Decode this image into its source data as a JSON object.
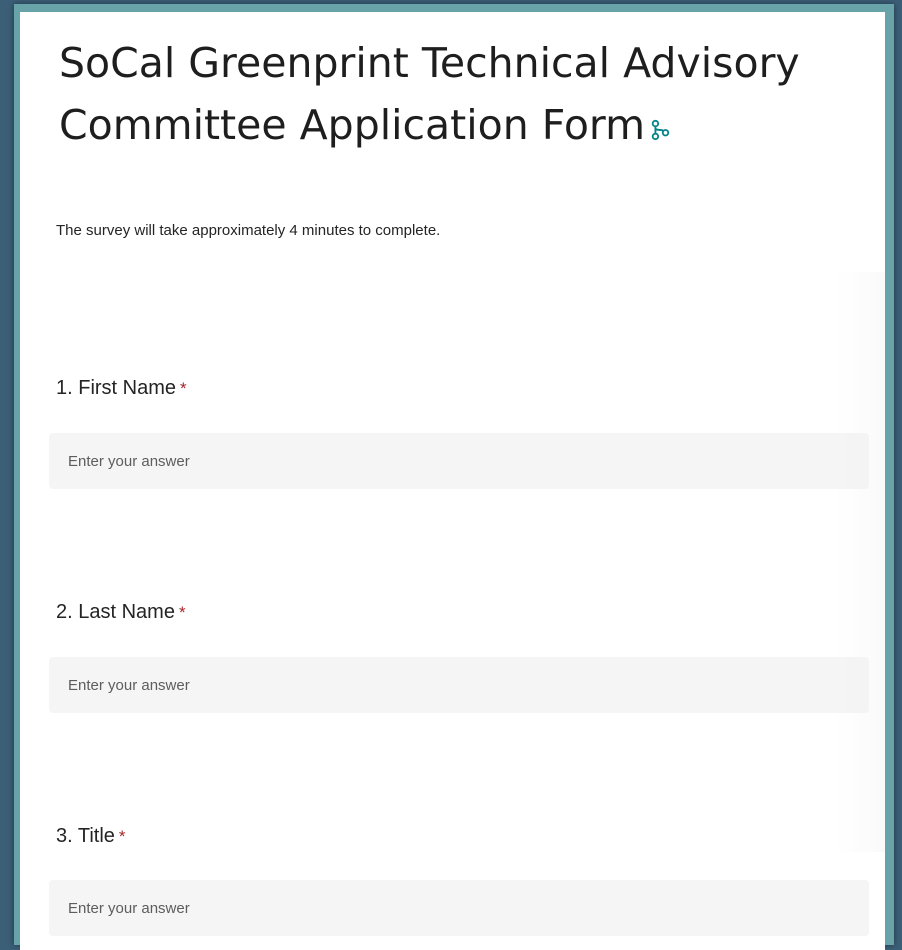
{
  "form": {
    "title": "SoCal Greenprint Technical Advisory Committee Application Form",
    "title_icon": "branch-icon",
    "description": "The survey will take approximately 4 minutes to complete.",
    "required_marker": "*",
    "questions": [
      {
        "label": "1. First Name",
        "placeholder": "Enter your answer",
        "required": true
      },
      {
        "label": "2. Last Name",
        "placeholder": "Enter your answer",
        "required": true
      },
      {
        "label": "3. Title",
        "placeholder": "Enter your answer",
        "required": true
      }
    ]
  },
  "colors": {
    "background": "#3c5f78",
    "frame": "#67a3a8",
    "card": "#ffffff",
    "input_bg": "#f5f5f5",
    "required": "#a4262c",
    "icon_teal": "#038387"
  }
}
